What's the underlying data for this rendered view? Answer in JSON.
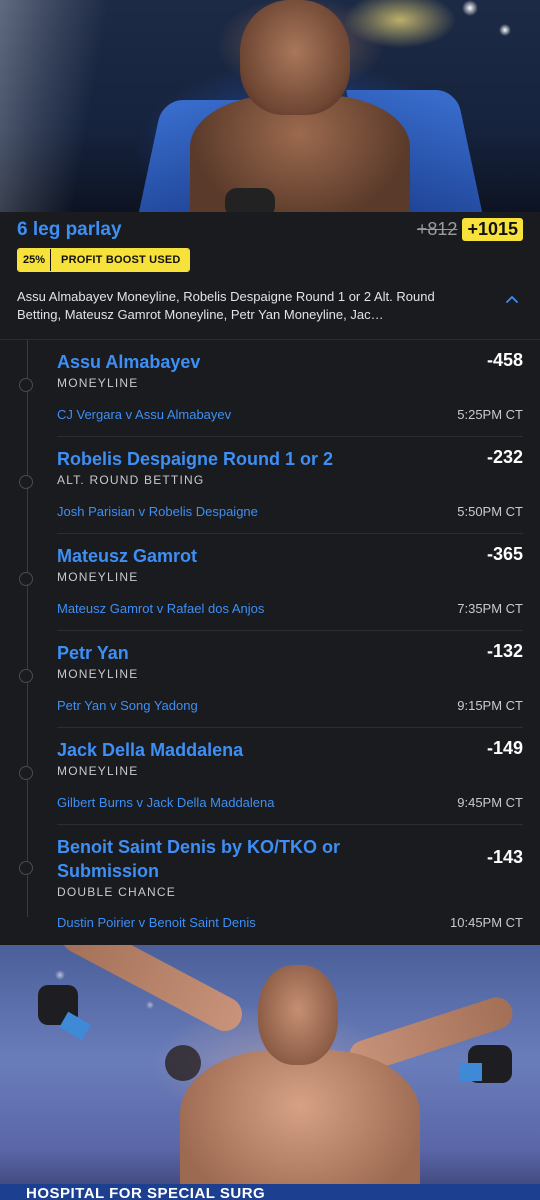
{
  "header": {
    "title": "6 leg parlay",
    "odds_original": "+812",
    "odds_boosted": "+1015",
    "boost_percent": "25%",
    "boost_label": "PROFIT BOOST USED",
    "summary": "Assu Almabayev Moneyline, Robelis Despaigne Round 1 or 2 Alt. Round Betting, Mateusz Gamrot Moneyline, Petr Yan Moneyline, Jac…"
  },
  "legs": [
    {
      "selection": "Assu Almabayev",
      "market": "MONEYLINE",
      "odds": "-458",
      "matchup": "CJ Vergara v Assu Almabayev",
      "time": "5:25PM CT"
    },
    {
      "selection": "Robelis Despaigne Round 1 or 2",
      "market": "ALT. ROUND BETTING",
      "odds": "-232",
      "matchup": "Josh Parisian v Robelis Despaigne",
      "time": "5:50PM CT"
    },
    {
      "selection": "Mateusz Gamrot",
      "market": "MONEYLINE",
      "odds": "-365",
      "matchup": "Mateusz Gamrot v Rafael dos Anjos",
      "time": "7:35PM CT"
    },
    {
      "selection": "Petr Yan",
      "market": "MONEYLINE",
      "odds": "-132",
      "matchup": "Petr Yan v Song Yadong",
      "time": "9:15PM CT"
    },
    {
      "selection": "Jack Della Maddalena",
      "market": "MONEYLINE",
      "odds": "-149",
      "matchup": "Gilbert Burns v Jack Della Maddalena",
      "time": "9:45PM CT"
    },
    {
      "selection": "Benoit Saint Denis by KO/TKO or Submission",
      "market": "DOUBLE CHANCE",
      "odds": "-143",
      "matchup": "Dustin Poirier v Benoit Saint Denis",
      "time": "10:45PM CT"
    }
  ],
  "photo_bottom": {
    "banner_text": "HOSPITAL FOR SPECIAL SURG"
  },
  "colors": {
    "accent_blue": "#3d8ff5",
    "boost_yellow": "#f7e23b",
    "card_bg": "#1a1b1f"
  }
}
